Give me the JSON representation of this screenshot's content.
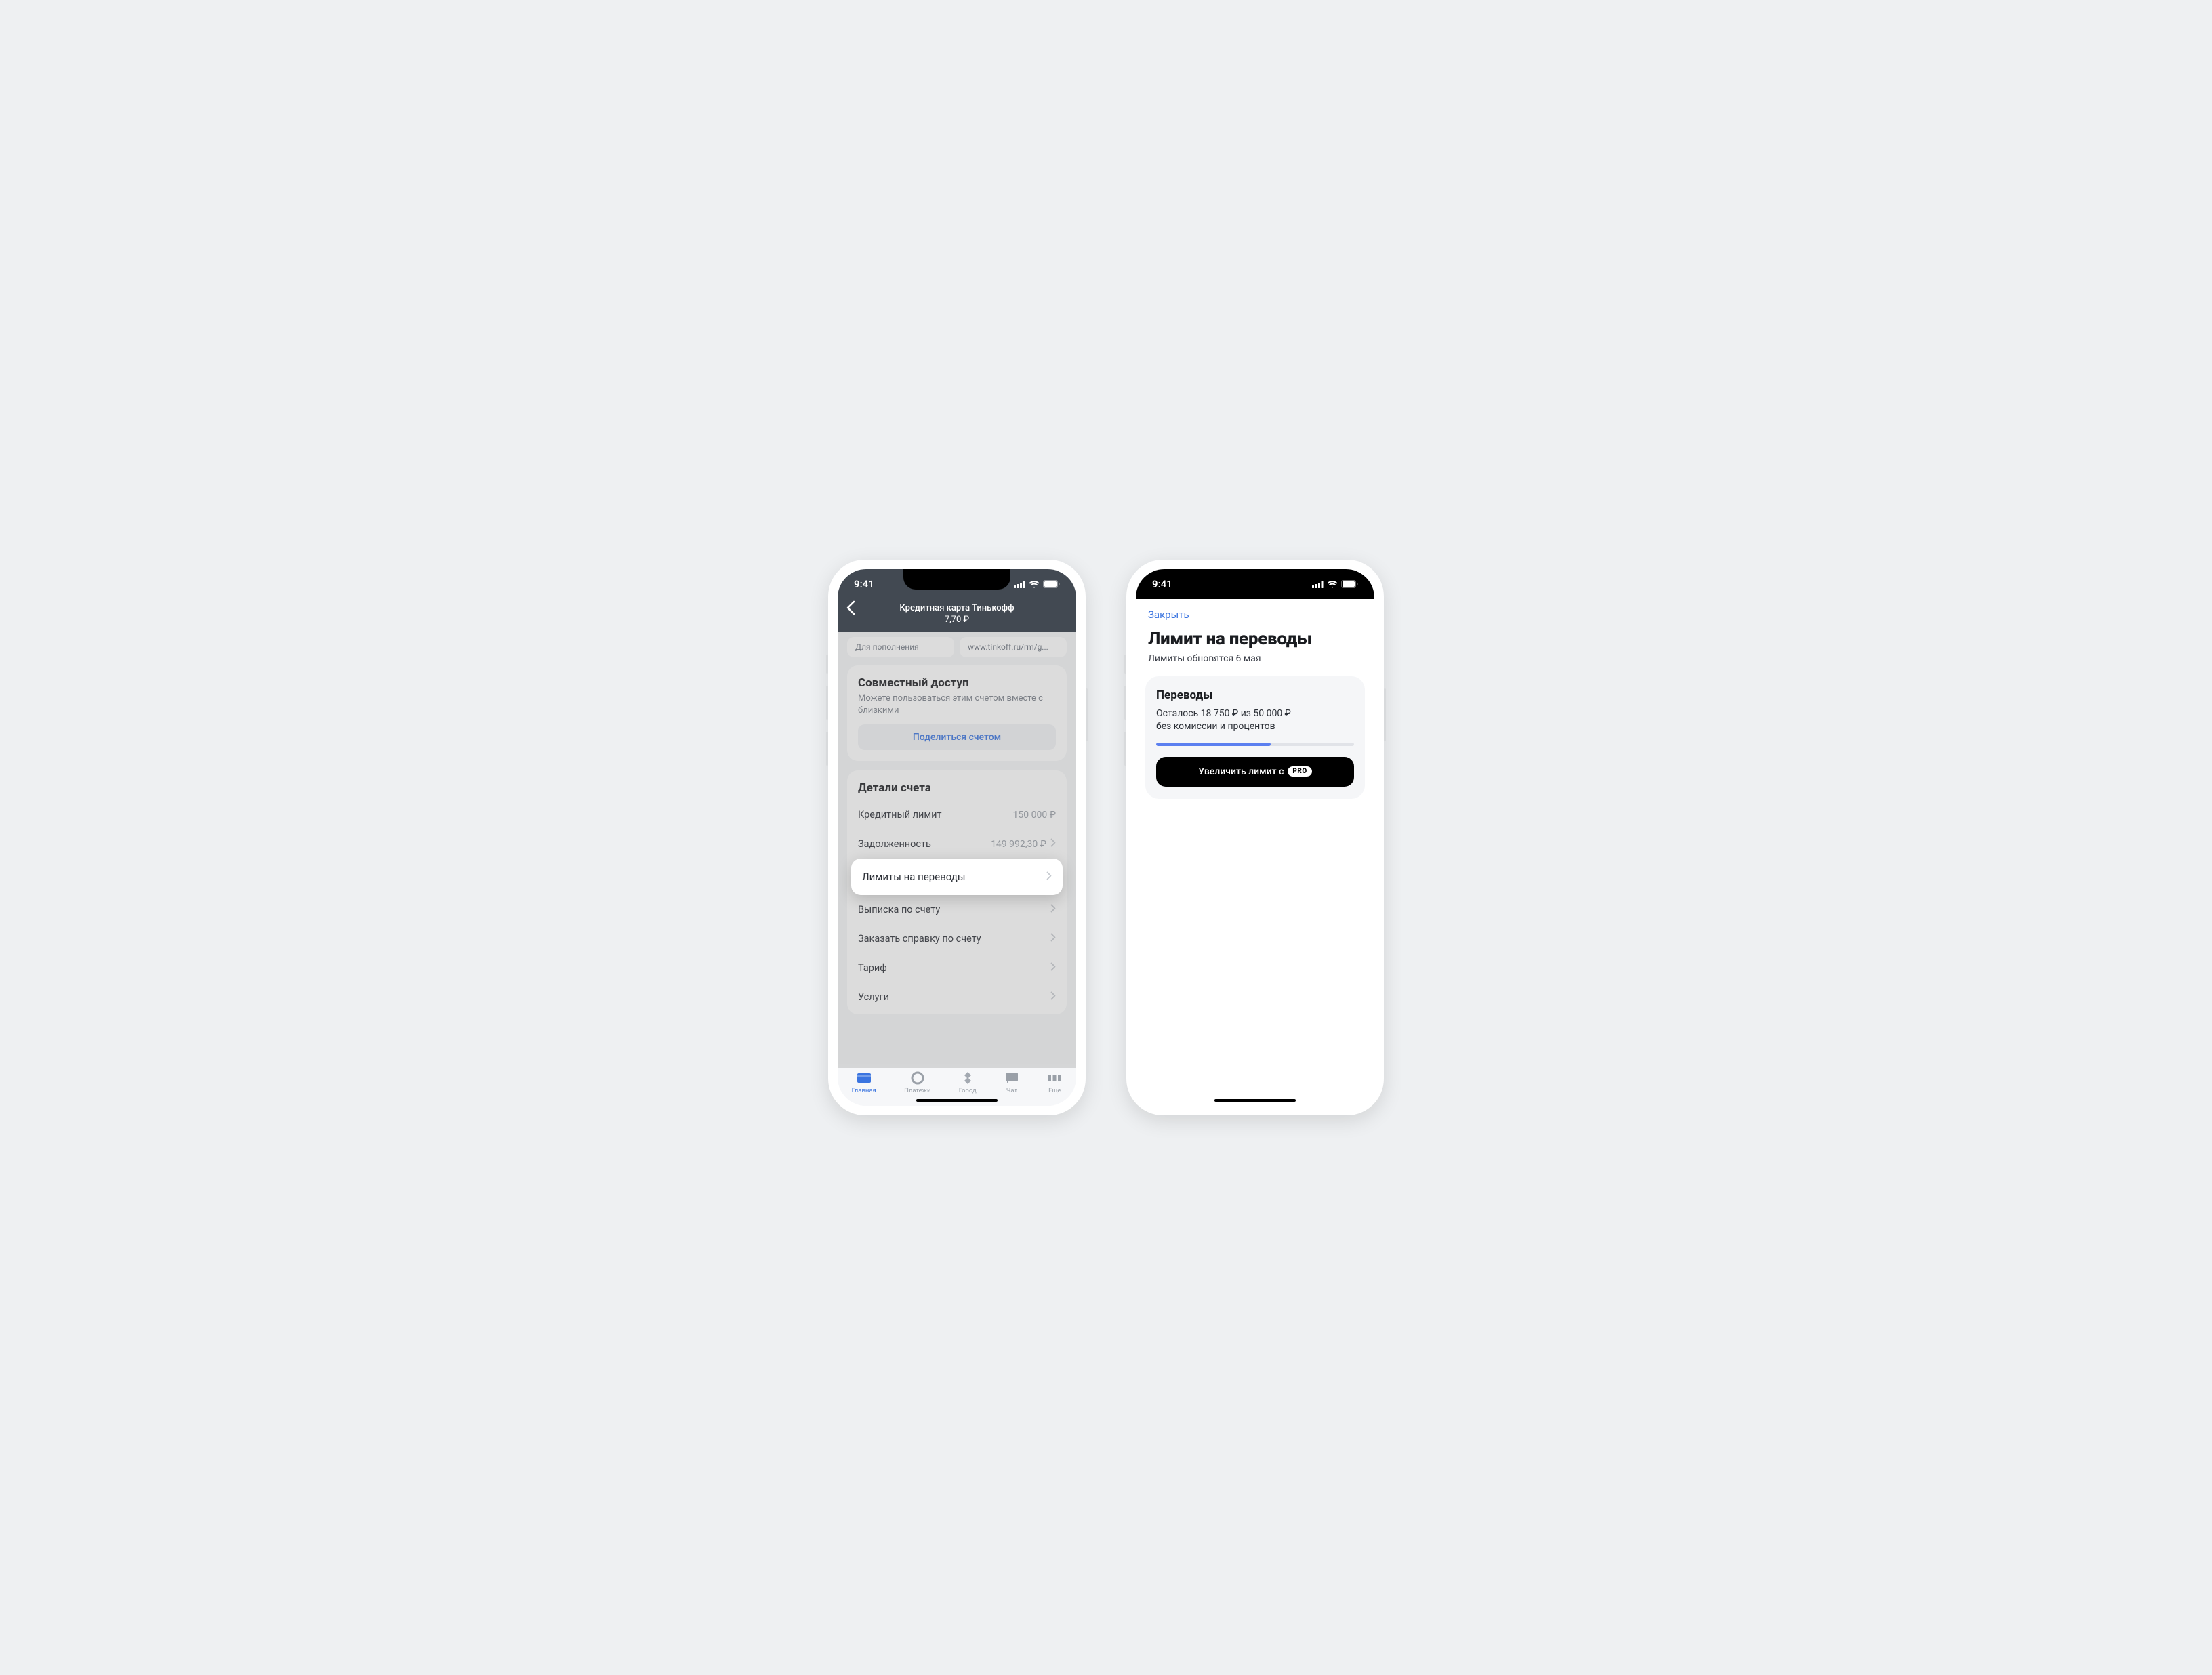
{
  "status": {
    "time": "9:41"
  },
  "left": {
    "header": {
      "title": "Кредитная карта Тинькофф",
      "subtitle": "7,70 ₽"
    },
    "chips": [
      "Для пополнения",
      "www.tinkoff.ru/rm/g..."
    ],
    "share": {
      "title": "Совместный доступ",
      "desc": "Можете пользоваться этим счетом вместе с близкими",
      "button": "Поделиться счетом"
    },
    "details": {
      "title": "Детали счета",
      "rows": [
        {
          "label": "Кредитный лимит",
          "value": "150 000 ₽",
          "chevron": false
        },
        {
          "label": "Задолженность",
          "value": "149 992,30 ₽",
          "chevron": true
        },
        {
          "label": "Лимиты на переводы",
          "value": "",
          "chevron": true,
          "highlight": true
        },
        {
          "label": "Выписка по счету",
          "value": "",
          "chevron": true
        },
        {
          "label": "Заказать справку по счету",
          "value": "",
          "chevron": true
        },
        {
          "label": "Тариф",
          "value": "",
          "chevron": true
        },
        {
          "label": "Услуги",
          "value": "",
          "chevron": true
        }
      ]
    },
    "tabs": [
      "Главная",
      "Платежи",
      "Город",
      "Чат",
      "Еще"
    ]
  },
  "right": {
    "close": "Закрыть",
    "title": "Лимит на переводы",
    "subtitle": "Лимиты обновятся 6 мая",
    "card": {
      "title": "Переводы",
      "line1": "Осталось 18 750 ₽ из 50 000 ₽",
      "line2": "без комиссии и процентов",
      "button_text": "Увеличить лимит с",
      "pro": "PRO",
      "progress_pct": 58
    }
  }
}
